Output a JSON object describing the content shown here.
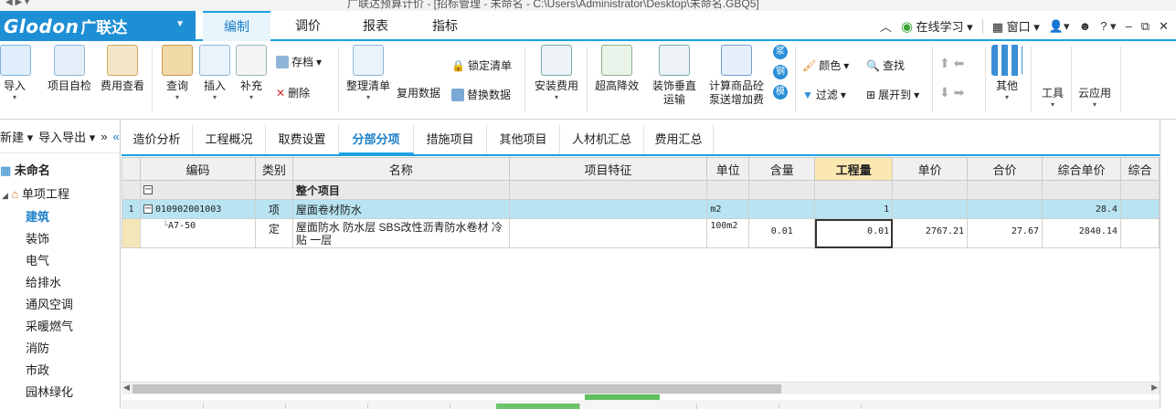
{
  "window": {
    "title_text": "广联达预算计价 - [招标管理 - 未命名 - C:\\Users\\Administrator\\Desktop\\未命名.GBQ5]"
  },
  "topbar": {
    "logo_en": "Glodon",
    "logo_cn": "广联达",
    "menu_tabs": [
      "编制",
      "调价",
      "报表",
      "指标"
    ],
    "online_learning": "在线学习",
    "window_menu": "窗口",
    "help": "?"
  },
  "ribbon": {
    "buttons_large": [
      {
        "label": "导入",
        "icon": "import-icon"
      },
      {
        "label": "项目自检",
        "icon": "project-check-icon"
      },
      {
        "label": "费用查看",
        "icon": "fee-view-icon"
      },
      {
        "label": "查询",
        "icon": "query-icon"
      },
      {
        "label": "插入",
        "icon": "insert-icon"
      },
      {
        "label": "补充",
        "icon": "supplement-icon"
      },
      {
        "label": "整理清单",
        "icon": "organize-list-icon"
      },
      {
        "label": "安装费用",
        "icon": "install-fee-icon"
      },
      {
        "label": "超高降效",
        "icon": "height-reduce-icon"
      },
      {
        "label": "装饰垂直\n运输",
        "icon": "vertical-transport-icon"
      },
      {
        "label": "计算商品砼\n泵送增加费",
        "icon": "concrete-pump-icon"
      },
      {
        "label": "其他",
        "icon": "other-grid-icon"
      },
      {
        "label": "工具",
        "icon": "tools-icon"
      },
      {
        "label": "云应用",
        "icon": "cloud-icon"
      }
    ],
    "small": {
      "save": "存档",
      "delete": "删除",
      "lock_list": "锁定清单",
      "reuse_data": "复用数据",
      "replace_data": "替换数据",
      "color": "颜色",
      "find": "查找",
      "filter": "过滤",
      "expand_to": "展开到",
      "side_badges": [
        "浆",
        "钢",
        "模"
      ]
    }
  },
  "left_panel": {
    "toolbar": {
      "new": "新建",
      "import_export": "导入导出"
    },
    "root": "未命名",
    "single_project": "单项工程",
    "items": [
      "建筑",
      "装饰",
      "电气",
      "给排水",
      "通风空调",
      "采暖燃气",
      "消防",
      "市政",
      "园林绿化"
    ],
    "selected": "建筑"
  },
  "doc_tabs": [
    "造价分析",
    "工程概况",
    "取费设置",
    "分部分项",
    "措施项目",
    "其他项目",
    "人材机汇总",
    "费用汇总"
  ],
  "active_doc_tab": "分部分项",
  "grid": {
    "headers": [
      "编码",
      "类别",
      "名称",
      "项目特征",
      "单位",
      "含量",
      "工程量",
      "单价",
      "合价",
      "综合单价",
      "综合"
    ],
    "rows": [
      {
        "no": "",
        "code": "",
        "type": "",
        "name": "整个项目",
        "feature": "",
        "unit": "",
        "content": "",
        "qty": "",
        "price": "",
        "total": "",
        "unit_total": ""
      },
      {
        "no": "1",
        "code": "010902001003",
        "type": "项",
        "name": "屋面卷材防水",
        "feature": "",
        "unit": "m2",
        "content": "",
        "qty": "1",
        "price": "",
        "total": "",
        "unit_total": "28.4"
      },
      {
        "no": "",
        "code": "A7-50",
        "type": "定",
        "name": "屋面防水 防水层 SBS改性沥青防水卷材 冷贴 一层",
        "feature": "",
        "unit": "100m2",
        "content": "0.01",
        "qty": "0.01",
        "price": "2767.21",
        "total": "27.67",
        "unit_total": "2840.14"
      }
    ]
  },
  "colors": {
    "accent": "#1ba1e2",
    "logo_bg": "#1e8fd5",
    "selected_row": "#b8e4f2",
    "highlight_header": "#fbe7b0"
  }
}
